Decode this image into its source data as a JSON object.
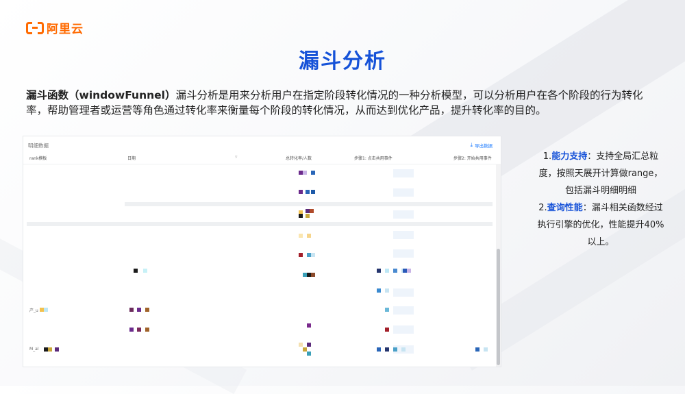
{
  "brand": {
    "name": "阿里云",
    "color": "#ff6a00"
  },
  "title": "漏斗分析",
  "intro": {
    "keyword": "漏斗函数（windowFunnel）",
    "text": "漏斗分析是用来分析用户在指定阶段转化情况的一种分析模型，可以分析用户在各个阶段的行为转化率，帮助管理者或运营等角色通过转化率来衡量每个阶段的转化情况，从而达到优化产品，提升转化率的目的。"
  },
  "panel": {
    "title": "明细数据",
    "export_label": "导出数据",
    "export_icon": "download-icon",
    "columns": [
      {
        "label": "rank模板"
      },
      {
        "label": "日期"
      },
      {
        "label": "总转化率/人数"
      },
      {
        "label": "步骤1: 点击共用事件"
      },
      {
        "label": "步骤2: 开始共用事件"
      }
    ],
    "row_refs": [
      "产_u",
      "M_al"
    ]
  },
  "notes": [
    {
      "num": "1.",
      "heading": "能力支持",
      "text": "：支持全局汇总粒度，按照天展开计算做range，包括漏斗明细明细"
    },
    {
      "num": "2.",
      "heading": "查询性能",
      "text": "：漏斗相关函数经过执行引擎的优化，性能提升40%以上。"
    }
  ],
  "colors": {
    "accent": "#1652d8",
    "brand": "#ff6a00"
  }
}
